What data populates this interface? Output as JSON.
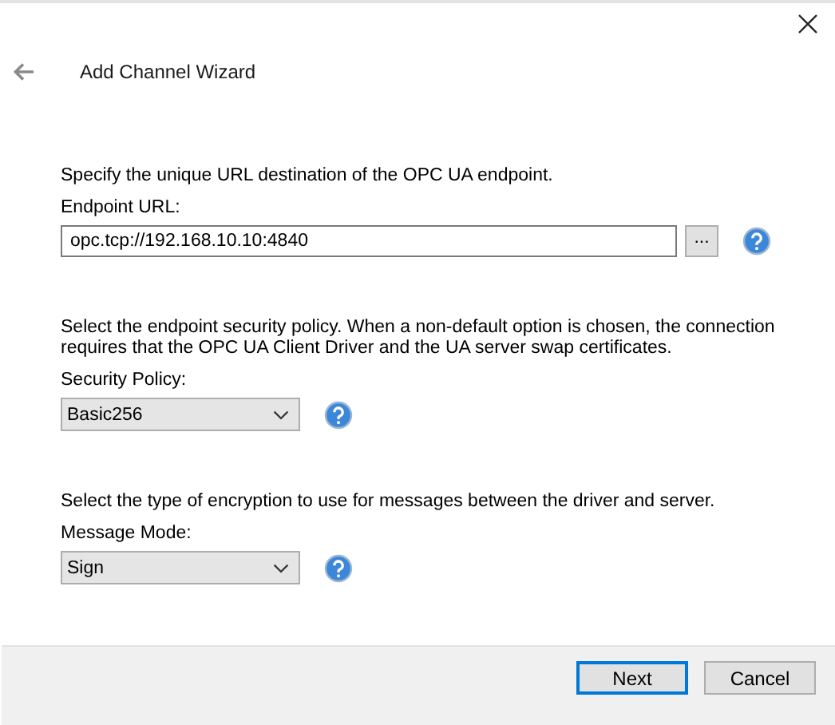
{
  "window": {
    "title": "Add Channel Wizard"
  },
  "sections": [
    {
      "kind": "text",
      "description": "Specify the unique URL destination of the OPC UA endpoint.",
      "label": "Endpoint URL:",
      "value": "opc.tcp://192.168.10.10:4840",
      "browse_button": "..."
    },
    {
      "kind": "dropdown",
      "description": "Select the endpoint security policy. When a non-default option is chosen, the connection requires that the OPC UA Client Driver and the UA server swap certificates.",
      "label": "Security Policy:",
      "value": "Basic256"
    },
    {
      "kind": "dropdown",
      "description": "Select the type of encryption to use for messages between the driver and server.",
      "label": "Message Mode:",
      "value": "Sign"
    }
  ],
  "buttons": [
    {
      "label": "Next",
      "default": true
    },
    {
      "label": "Cancel",
      "default": false
    }
  ]
}
